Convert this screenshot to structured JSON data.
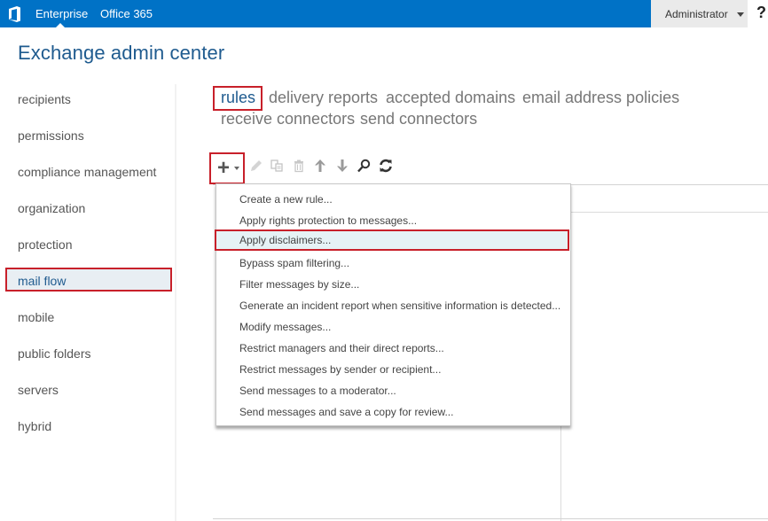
{
  "topbar": {
    "logo": "office-logo-icon",
    "links": [
      "Enterprise",
      "Office 365"
    ],
    "user": "Administrator",
    "help": "?"
  },
  "app": {
    "title": "Exchange admin center"
  },
  "left_nav": {
    "items": [
      {
        "label": "recipients"
      },
      {
        "label": "permissions"
      },
      {
        "label": "compliance management"
      },
      {
        "label": "organization"
      },
      {
        "label": "protection"
      },
      {
        "label": "mail flow",
        "selected": true
      },
      {
        "label": "mobile"
      },
      {
        "label": "public folders"
      },
      {
        "label": "servers"
      },
      {
        "label": "hybrid"
      }
    ]
  },
  "subtabs": {
    "items": [
      {
        "label": "rules",
        "active": true
      },
      {
        "label": "delivery reports"
      },
      {
        "label": "accepted domains"
      },
      {
        "label": "email address policies"
      },
      {
        "label": "receive connectors"
      },
      {
        "label": "send connectors"
      }
    ]
  },
  "toolbar": {
    "buttons": [
      "add",
      "edit",
      "copy",
      "delete",
      "move-up",
      "move-down",
      "search",
      "refresh"
    ],
    "add_symbol": "+"
  },
  "new_rule_menu": {
    "items": [
      "Create a new rule...",
      "Apply rights protection to messages...",
      "Apply disclaimers...",
      "Bypass spam filtering...",
      "Filter messages by size...",
      "Generate an incident report when sensitive information is detected...",
      "Modify messages...",
      "Restrict managers and their direct reports...",
      "Restrict messages by sender or recipient...",
      "Send messages to a moderator...",
      "Send messages and save a copy for review..."
    ],
    "highlighted_index": 2
  },
  "colors": {
    "brand_blue": "#0072c6",
    "title_blue": "#1f5b8f",
    "highlight_red": "#c8202a",
    "selected_bg": "#e8eef3",
    "menu_highlight_bg": "#e6f2f5"
  }
}
